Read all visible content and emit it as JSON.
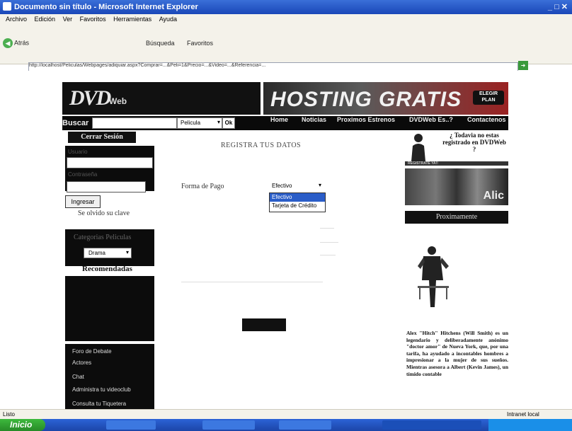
{
  "window": {
    "title": "Documento sin título - Microsoft Internet Explorer"
  },
  "menu": [
    "Archivo",
    "Edición",
    "Ver",
    "Favoritos",
    "Herramientas",
    "Ayuda"
  ],
  "toolbar": {
    "back_label": "Atrás",
    "search_label": "Búsqueda",
    "favorites_label": "Favoritos"
  },
  "address": {
    "url": "http://localhost/Peliculas/Webpages/adiquiar.aspx?Comprar=...&Peli=1&Precio=...&Video=...&Referencia=...",
    "go_label": "Ir"
  },
  "site": {
    "logo_big": "DVD",
    "logo_small": "Web",
    "hosting": "HOSTING GRATIS",
    "elegir_plan": "ELEGIR PLAN",
    "buscar_label": "Buscar",
    "search_select": "Pelicula",
    "ok_label": "Ok",
    "nav": [
      "Home",
      "Noticias",
      "Proximos Estrenos",
      "DVDWeb Es..?",
      "Contactenos"
    ],
    "cerrar_sesion": "Cerrar Sesión",
    "usuario_label": "Usuario",
    "contrasena_label": "Contraseña",
    "ingresar": "Ingresar",
    "olvido": "Se olvido su clave",
    "categorias_label": "Categorias Peliculas",
    "categoria_value": "Drama",
    "recomendadas": "Recomendadas",
    "links": [
      "Foro de Debate",
      "Actores",
      "Chat",
      "Administra tu videoclub",
      "Consulta tu Tiquetera"
    ],
    "reg_title": "REGISTRA TUS DATOS",
    "pago_label": "Forma de Pago",
    "pago_value": "Efectivo",
    "pago_options": [
      "Efectivo",
      "Tarjeta de Crédito"
    ],
    "registro_q": "¿ Todavia no estas registrado en DVDWeb ?",
    "registrate": "REGISTRATE YA!!",
    "proximamente": "Proximamente",
    "synopsis": "Alex \"Hitch\" Hitchens (Will Smith) es un legendario y deliberadamente anónimo \"doctor amor\" de Nueva York, que, por una tarifa, ha ayudado a incontables hombres a impresionar a la mujer de sus sueños. Mientras asesora a Albert (Kevin James), un tímido contable"
  },
  "status": {
    "left": "Listo",
    "right": "Intranet local"
  },
  "taskbar": {
    "start": "Inicio"
  }
}
